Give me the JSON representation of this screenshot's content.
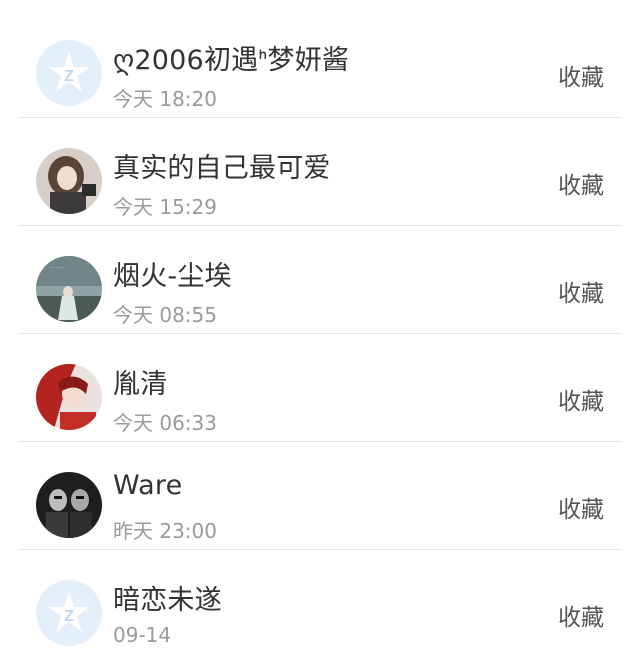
{
  "action_label": "收藏",
  "colors": {
    "name": "#333333",
    "time": "#9a9a9a",
    "action": "#555555",
    "divider": "#e6e6e6",
    "qzone_avatar_bg": "#e3effa"
  },
  "contacts": [
    {
      "name": "ღ2006初遇ᑋ梦妍酱",
      "time": "今天 18:20",
      "avatar_icon": "qzone-default-avatar-icon"
    },
    {
      "name": "真实的自己最可爱",
      "time": "今天 15:29",
      "avatar_icon": "photo-avatar"
    },
    {
      "name": "烟火-尘埃",
      "time": "今天 08:55",
      "avatar_icon": "photo-avatar"
    },
    {
      "name": "胤清",
      "time": "今天 06:33",
      "avatar_icon": "photo-avatar"
    },
    {
      "name": "Ware",
      "time": "昨天 23:00",
      "avatar_icon": "photo-avatar"
    },
    {
      "name": "暗恋未遂",
      "time": "09-14",
      "avatar_icon": "qzone-default-avatar-icon"
    }
  ]
}
